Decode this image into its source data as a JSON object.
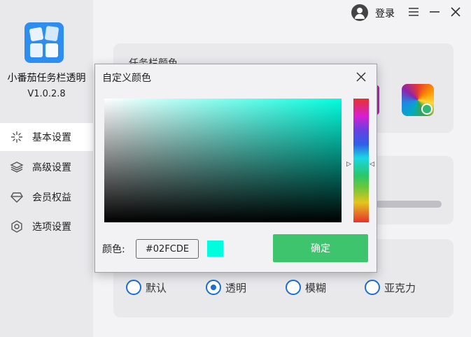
{
  "app": {
    "name": "小番茄任务栏透明",
    "version": "V1.0.2.8"
  },
  "sidebar": {
    "items": [
      {
        "label": "基本设置",
        "icon": "sparkle-icon",
        "active": true
      },
      {
        "label": "高级设置",
        "icon": "layers-icon",
        "active": false
      },
      {
        "label": "会员权益",
        "icon": "diamond-icon",
        "active": false
      },
      {
        "label": "选项设置",
        "icon": "gear-icon",
        "active": false
      }
    ]
  },
  "topbar": {
    "login_label": "登录",
    "icons": [
      "user-avatar-icon",
      "menu-icon",
      "minimize-icon",
      "close-icon"
    ]
  },
  "main": {
    "taskbar_color_card_title": "任务栏颜色",
    "styles": [
      {
        "label": "默认",
        "selected": false
      },
      {
        "label": "透明",
        "selected": true
      },
      {
        "label": "模糊",
        "selected": false
      },
      {
        "label": "亚克力",
        "selected": false
      }
    ]
  },
  "dialog": {
    "title": "自定义颜色",
    "color_label": "颜色:",
    "hex_value": "#02FCDE",
    "confirm_label": "确定",
    "selected_color": "#02fcde"
  },
  "colors": {
    "accent_blue": "#1b6ed2",
    "confirm_green": "#3ec46d",
    "sidebar_bg": "#e9e9ec"
  }
}
